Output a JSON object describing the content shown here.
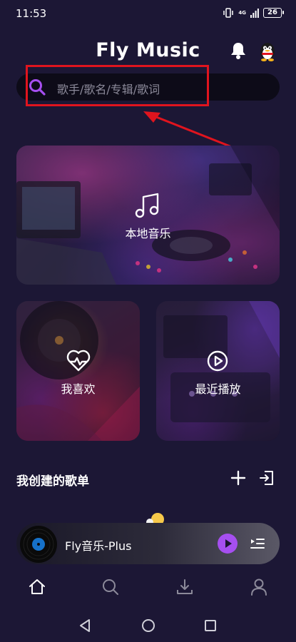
{
  "status_bar": {
    "time": "11:53",
    "network": "4G",
    "battery": "26"
  },
  "header": {
    "title": "Fly Music",
    "bell_icon": "bell-icon",
    "avatar_icon": "penguin-avatar"
  },
  "search": {
    "placeholder": "歌手/歌名/专辑/歌词",
    "accent_color": "#a64ff0"
  },
  "annotation": {
    "highlight_color": "#e0141e"
  },
  "cards": {
    "local": {
      "label": "本地音乐",
      "icon": "music-note-icon"
    },
    "favorites": {
      "label": "我喜欢",
      "icon": "heart-pulse-icon"
    },
    "recent": {
      "label": "最近播放",
      "icon": "play-circle-icon"
    }
  },
  "playlists": {
    "title": "我创建的歌单",
    "add_icon": "plus-icon",
    "import_icon": "import-icon"
  },
  "player": {
    "track": "Fly音乐-Plus",
    "play_icon": "play-icon",
    "queue_icon": "queue-icon"
  },
  "bottom_nav": [
    "home-icon",
    "search-icon",
    "download-icon",
    "profile-icon"
  ],
  "system_nav": [
    "back",
    "home",
    "recents"
  ]
}
